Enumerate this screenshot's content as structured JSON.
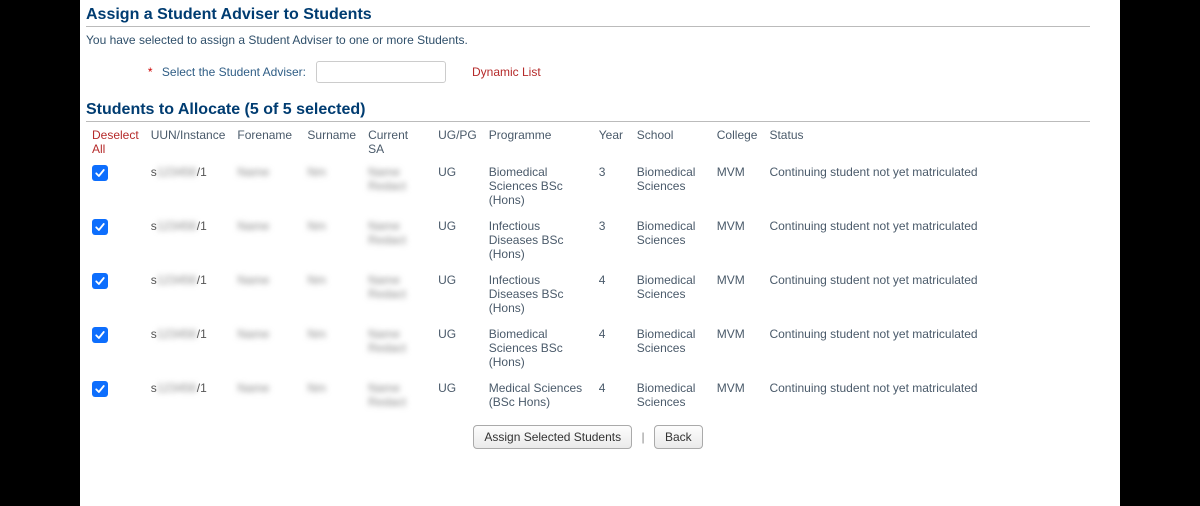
{
  "page": {
    "title": "Assign a Student Adviser to Students",
    "intro": "You have selected to assign a Student Adviser to one or more Students."
  },
  "form": {
    "required_marker": "*",
    "adviser_label": "Select the Student Adviser:",
    "adviser_value": "",
    "adviser_placeholder": "",
    "dynamic_list_label": "Dynamic List"
  },
  "students": {
    "section_title": "Students to Allocate (5 of 5 selected)",
    "deselect_all_label": "Deselect All",
    "headers": {
      "uun": "UUN/Instance",
      "forename": "Forename",
      "surname": "Surname",
      "current_sa": "Current SA",
      "ugpg": "UG/PG",
      "programme": "Programme",
      "year": "Year",
      "school": "School",
      "college": "College",
      "status": "Status"
    },
    "rows": [
      {
        "checked": true,
        "uun_prefix": "s",
        "uun_blurred": "123456",
        "uun_suffix": "/1",
        "forename_blurred": "Name",
        "surname_blurred": "Nm",
        "sa_blurred": "Name Redact",
        "ugpg": "UG",
        "programme": "Biomedical Sciences BSc (Hons)",
        "year": "3",
        "school": "Biomedical Sciences",
        "college": "MVM",
        "status": "Continuing student not yet matriculated"
      },
      {
        "checked": true,
        "uun_prefix": "s",
        "uun_blurred": "123456",
        "uun_suffix": "/1",
        "forename_blurred": "Name",
        "surname_blurred": "Nm",
        "sa_blurred": "Name Redact",
        "ugpg": "UG",
        "programme": "Infectious Diseases BSc (Hons)",
        "year": "3",
        "school": "Biomedical Sciences",
        "college": "MVM",
        "status": "Continuing student not yet matriculated"
      },
      {
        "checked": true,
        "uun_prefix": "s",
        "uun_blurred": "123456",
        "uun_suffix": "/1",
        "forename_blurred": "Name",
        "surname_blurred": "Nm",
        "sa_blurred": "Name Redact",
        "ugpg": "UG",
        "programme": "Infectious Diseases BSc (Hons)",
        "year": "4",
        "school": "Biomedical Sciences",
        "college": "MVM",
        "status": "Continuing student not yet matriculated"
      },
      {
        "checked": true,
        "uun_prefix": "s",
        "uun_blurred": "123456",
        "uun_suffix": "/1",
        "forename_blurred": "Name",
        "surname_blurred": "Nm",
        "sa_blurred": "Name Redact",
        "ugpg": "UG",
        "programme": "Biomedical Sciences BSc (Hons)",
        "year": "4",
        "school": "Biomedical Sciences",
        "college": "MVM",
        "status": "Continuing student not yet matriculated"
      },
      {
        "checked": true,
        "uun_prefix": "s",
        "uun_blurred": "123456",
        "uun_suffix": "/1",
        "forename_blurred": "Name",
        "surname_blurred": "Nm",
        "sa_blurred": "Name Redact",
        "ugpg": "UG",
        "programme": "Medical Sciences (BSc Hons)",
        "year": "4",
        "school": "Biomedical Sciences",
        "college": "MVM",
        "status": "Continuing student not yet matriculated"
      }
    ]
  },
  "actions": {
    "assign_label": "Assign Selected Students",
    "back_label": "Back"
  }
}
